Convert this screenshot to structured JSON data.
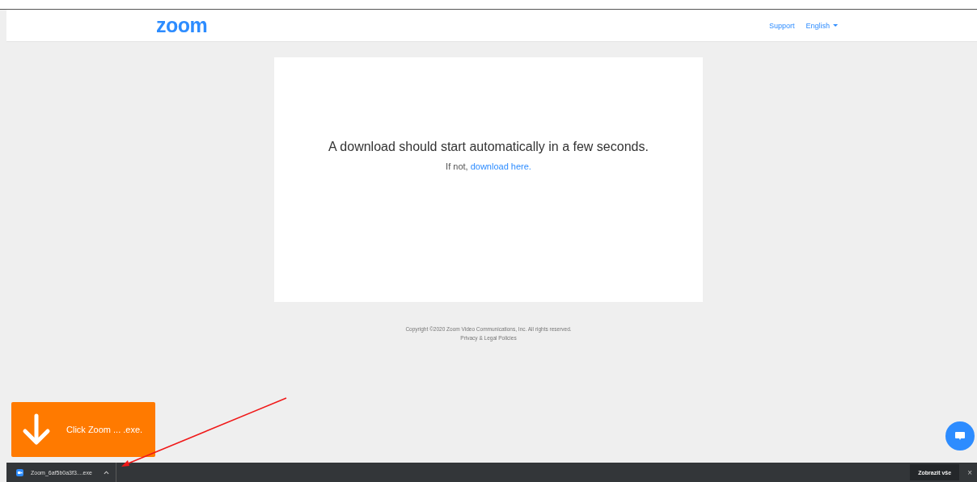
{
  "header": {
    "logo": "zoom",
    "links": [
      {
        "label": "Support",
        "dropdown": false
      },
      {
        "label": "English",
        "dropdown": true
      }
    ]
  },
  "card": {
    "heading": "A download should start automatically in a few seconds.",
    "fallback_text": "If not,",
    "fallback_link": "download here."
  },
  "footer": {
    "copyright": "Copyright ©2020 Zoom Video Communications, Inc. All rights reserved.",
    "policies": "Privacy & Legal Policies"
  },
  "hint": {
    "text": "Click Zoom ... .exe."
  },
  "download_bar": {
    "file": "Zoom_6af5b0a3f3....exe",
    "show_all": "Zobrazit vše",
    "close": "×"
  }
}
